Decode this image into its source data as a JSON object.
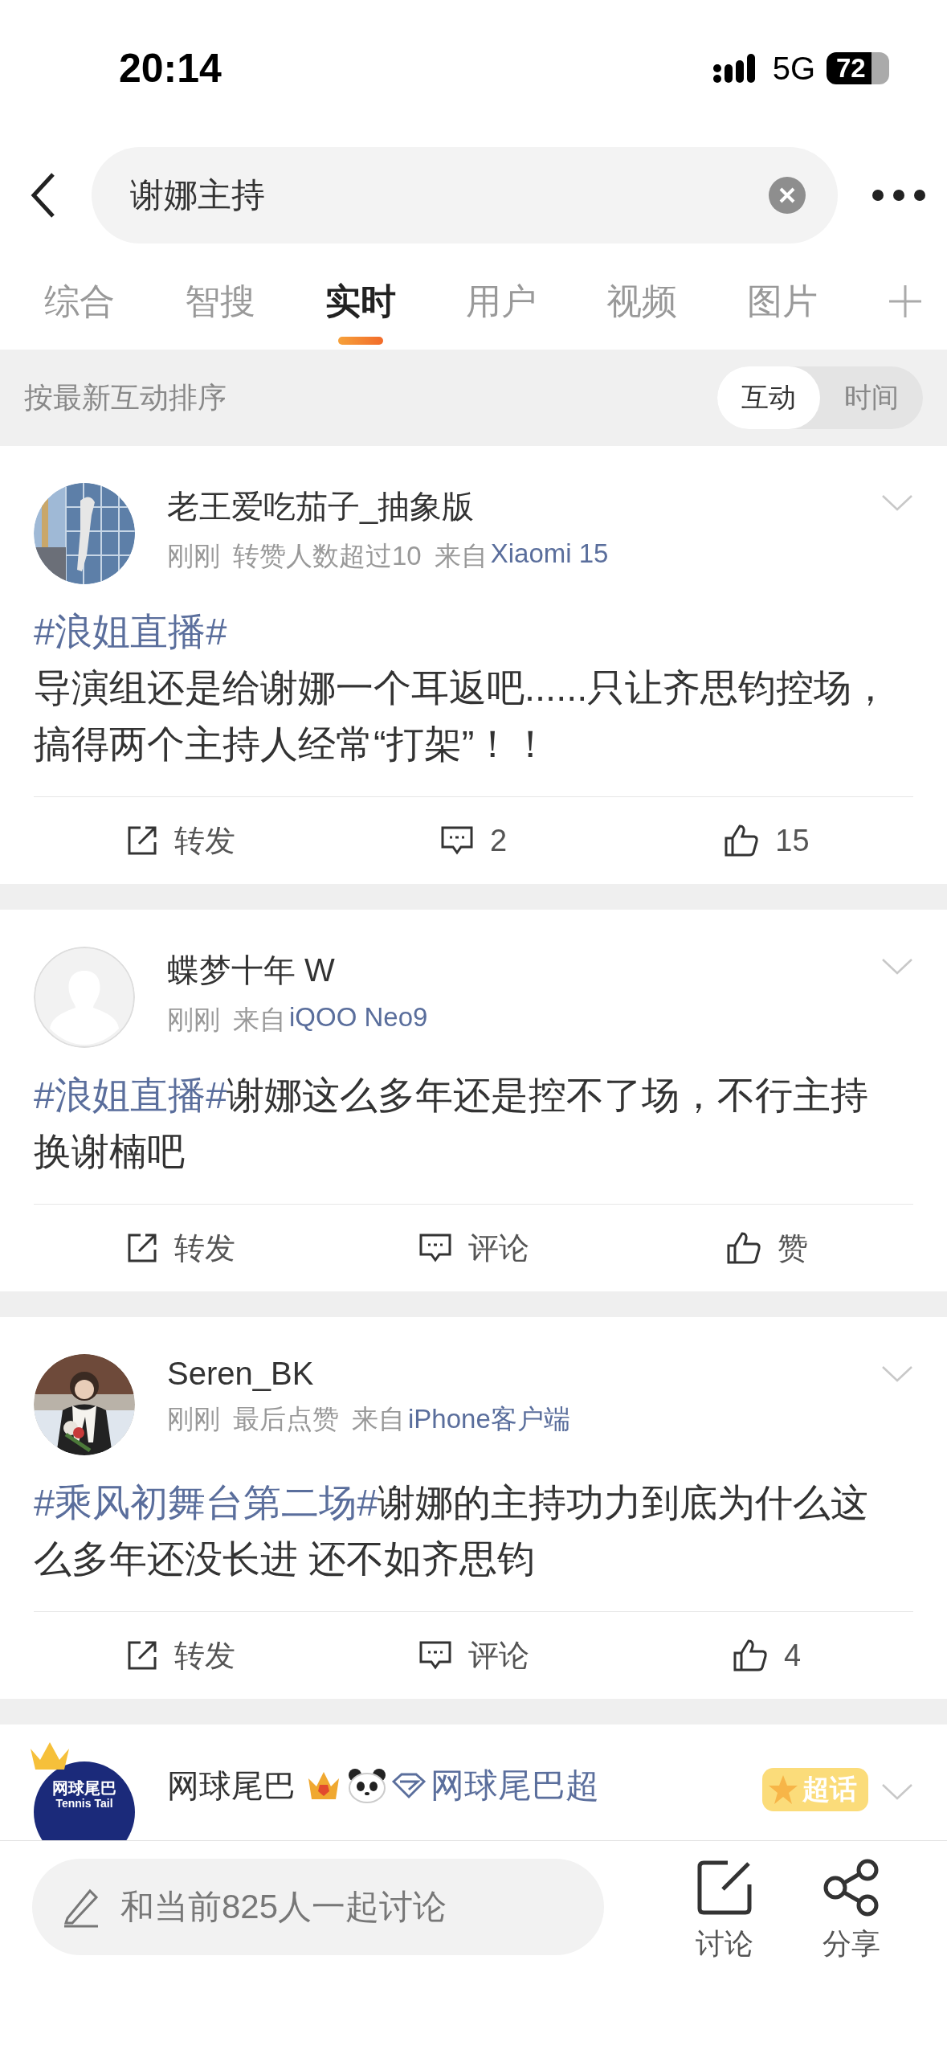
{
  "status_bar": {
    "time": "20:14",
    "network": "5G",
    "battery": "72"
  },
  "search": {
    "value": "谢娜主持"
  },
  "tabs": [
    {
      "label": "综合",
      "selected": false
    },
    {
      "label": "智搜",
      "selected": false
    },
    {
      "label": "实时",
      "selected": true
    },
    {
      "label": "用户",
      "selected": false
    },
    {
      "label": "视频",
      "selected": false
    },
    {
      "label": "图片",
      "selected": false
    }
  ],
  "sort": {
    "label": "按最新互动排序",
    "options": [
      {
        "label": "互动",
        "selected": true
      },
      {
        "label": "时间",
        "selected": false
      }
    ]
  },
  "posts": [
    {
      "avatar": {
        "kind": "building"
      },
      "author": "老王爱吃茄子_抽象版",
      "meta": {
        "time": "刚刚",
        "note": "转赞人数超过10",
        "from": "来自",
        "source": "Xiaomi 15"
      },
      "body": {
        "topic": "#浪姐直播#",
        "topic_own_line": true,
        "text": "导演组还是给谢娜一个耳返吧......只让齐思钧控场，搞得两个主持人经常“打架”！！"
      },
      "actions": [
        {
          "kind": "repost",
          "label": "转发"
        },
        {
          "kind": "comment",
          "label": "2"
        },
        {
          "kind": "like",
          "label": "15"
        }
      ]
    },
    {
      "avatar": {
        "kind": "default"
      },
      "author": "蝶梦十年 W",
      "meta": {
        "time": "刚刚",
        "from": "来自",
        "source": "iQOO Neo9"
      },
      "body": {
        "topic": "#浪姐直播#",
        "topic_own_line": false,
        "text": "谢娜这么多年还是控不了场，不行主持换谢楠吧"
      },
      "actions": [
        {
          "kind": "repost",
          "label": "转发"
        },
        {
          "kind": "comment",
          "label": "评论"
        },
        {
          "kind": "like",
          "label": "赞"
        }
      ]
    },
    {
      "avatar": {
        "kind": "person"
      },
      "author": "Seren_BK",
      "meta": {
        "time": "刚刚",
        "note": "最后点赞",
        "from": "来自",
        "source": "iPhone客户端"
      },
      "body": {
        "topic": "#乘风初舞台第二场#",
        "topic_own_line": false,
        "text": "谢娜的主持功力到底为什么这么多年还没长进 还不如齐思钧"
      },
      "actions": [
        {
          "kind": "repost",
          "label": "转发"
        },
        {
          "kind": "comment",
          "label": "评论"
        },
        {
          "kind": "like",
          "label": "4"
        }
      ]
    },
    {
      "avatar": {
        "kind": "logo",
        "lines": [
          "网球尾巴",
          "Tennis Tail"
        ]
      },
      "author": "网球尾巴",
      "badges": [
        {
          "kind": "crown"
        },
        {
          "kind": "panda"
        }
      ],
      "super_topic": "网球尾巴超",
      "sticker": "超话"
    }
  ],
  "composer": {
    "placeholder": "和当前825人一起讨论"
  },
  "bottom_actions": [
    {
      "kind": "discuss",
      "label": "讨论"
    },
    {
      "kind": "share",
      "label": "分享"
    }
  ]
}
